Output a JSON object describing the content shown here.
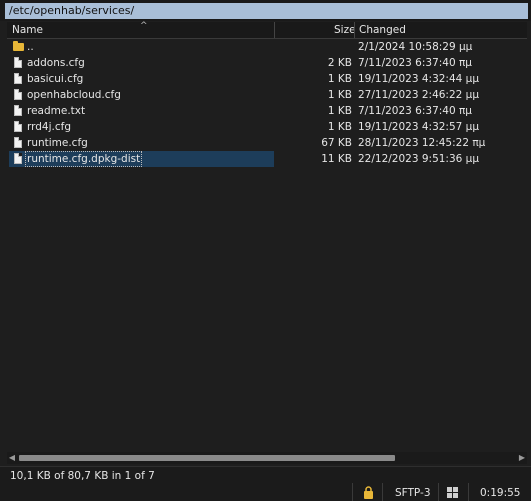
{
  "path": "/etc/openhab/services/",
  "columns": {
    "name": "Name",
    "size": "Size",
    "changed": "Changed"
  },
  "files": [
    {
      "name": "..",
      "size": "",
      "changed": "2/1/2024 10:58:29 μμ",
      "icon": "parent-folder-icon"
    },
    {
      "name": "addons.cfg",
      "size": "2 KB",
      "changed": "7/11/2023 6:37:40 πμ",
      "icon": "file-icon"
    },
    {
      "name": "basicui.cfg",
      "size": "1 KB",
      "changed": "19/11/2023 4:32:44 μμ",
      "icon": "file-icon"
    },
    {
      "name": "openhabcloud.cfg",
      "size": "1 KB",
      "changed": "27/11/2023 2:46:22 μμ",
      "icon": "file-icon"
    },
    {
      "name": "readme.txt",
      "size": "1 KB",
      "changed": "7/11/2023 6:37:40 πμ",
      "icon": "file-icon"
    },
    {
      "name": "rrd4j.cfg",
      "size": "1 KB",
      "changed": "19/11/2023 4:32:57 μμ",
      "icon": "file-icon"
    },
    {
      "name": "runtime.cfg",
      "size": "67 KB",
      "changed": "28/11/2023 12:45:22 πμ",
      "icon": "file-icon"
    },
    {
      "name": "runtime.cfg.dpkg-dist",
      "size": "11 KB",
      "changed": "22/12/2023 9:51:36 μμ",
      "icon": "file-icon",
      "selected": true
    }
  ],
  "status": {
    "selection": "10,1 KB of 80,7 KB in 1 of 7",
    "protocol": "SFTP-3",
    "elapsed": "0:19:55"
  },
  "colors": {
    "path_bg": "#a9bfd8",
    "selected_bg": "#1d3d5a",
    "folder": "#e8b738"
  }
}
